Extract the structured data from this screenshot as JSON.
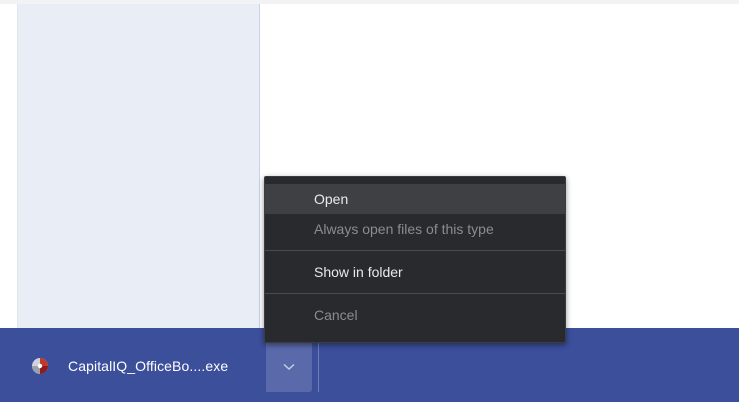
{
  "download_bar": {
    "background": "#3b4f9b",
    "item": {
      "file_name": "CapitalIQ_OfficeBo....exe",
      "icon": "capitaliq-app-icon"
    },
    "options_button_icon": "chevron-down-icon"
  },
  "context_menu": {
    "items": [
      {
        "label": "Open",
        "state": "highlighted"
      },
      {
        "label": "Always open files of this type",
        "state": "disabled"
      },
      {
        "label": "Show in folder",
        "state": "enabled"
      },
      {
        "label": "Cancel",
        "state": "disabled"
      }
    ]
  },
  "colors": {
    "menu_background": "#292a2d",
    "menu_highlight": "#3f4044",
    "side_panel": "#e8edf6"
  }
}
